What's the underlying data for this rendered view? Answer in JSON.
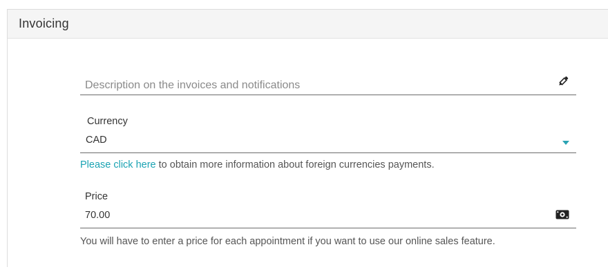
{
  "section": {
    "title": "Invoicing"
  },
  "description": {
    "placeholder": "Description on the invoices and notifications",
    "icon": "pencil-icon"
  },
  "currency": {
    "label": "Currency",
    "value": "CAD",
    "help_link": "Please click here",
    "help_text": " to obtain more information about foreign currencies payments.",
    "icon": "caret-down-icon",
    "accent_color": "#1ba3b3"
  },
  "price": {
    "label": "Price",
    "value": "70.00",
    "help_text": "You will have to enter a price for each appointment if you want to use our online sales feature.",
    "icon": "money-icon"
  }
}
